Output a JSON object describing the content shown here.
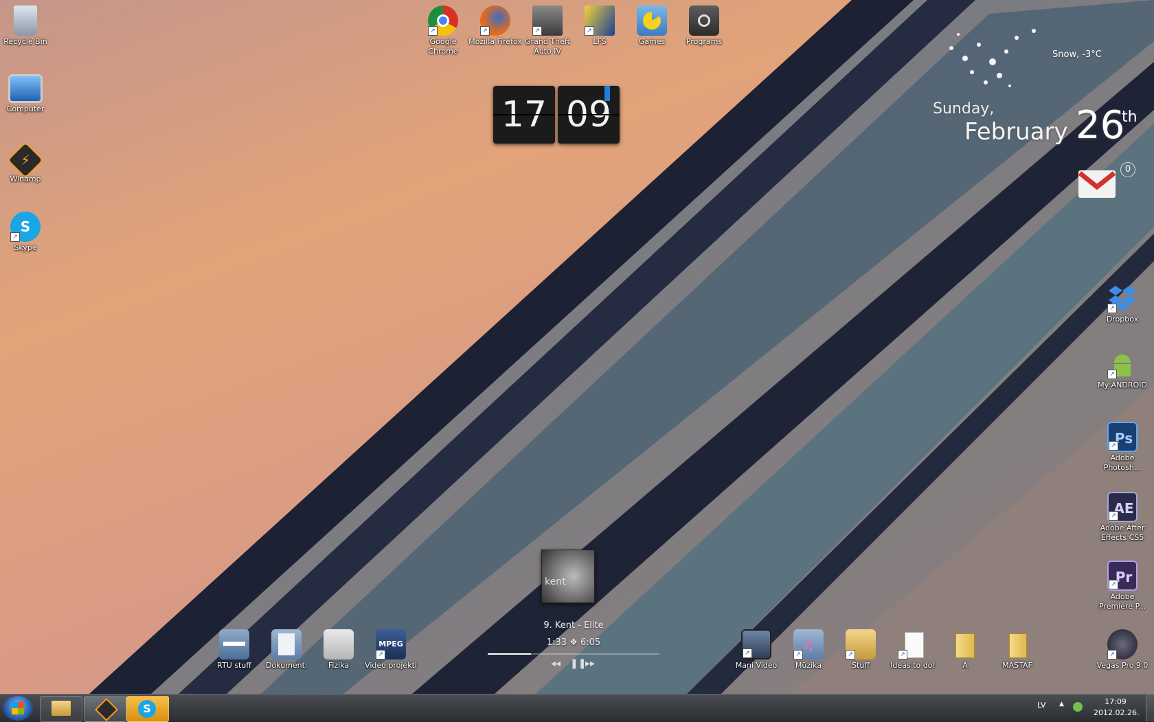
{
  "desktop": {
    "left_icons": [
      {
        "label": "Recycle Bin",
        "icon": "recycle-bin-icon"
      },
      {
        "label": "Computer",
        "icon": "computer-icon"
      },
      {
        "label": "Winamp",
        "icon": "winamp-icon"
      },
      {
        "label": "Skype",
        "icon": "skype-icon"
      }
    ],
    "top_icons": [
      {
        "label": "Google Chrome",
        "icon": "chrome-icon"
      },
      {
        "label": "Mozilla Firefox",
        "icon": "firefox-icon"
      },
      {
        "label": "Grand Theft Auto IV",
        "icon": "gta-icon"
      },
      {
        "label": "LFS",
        "icon": "lfs-icon"
      },
      {
        "label": "Games",
        "icon": "games-icon"
      },
      {
        "label": "Programs",
        "icon": "programs-icon"
      }
    ],
    "right_icons": [
      {
        "label": "Dropbox",
        "icon": "dropbox-icon"
      },
      {
        "label": "My ANDROID",
        "icon": "android-icon"
      },
      {
        "label": "Adobe Photosh...",
        "icon": "photoshop-icon",
        "glyph": "Ps"
      },
      {
        "label": "Adobe After Effects CS5",
        "icon": "after-effects-icon",
        "glyph": "AE"
      },
      {
        "label": "Adobe Premiere P...",
        "icon": "premiere-icon",
        "glyph": "Pr"
      },
      {
        "label": "Vegas Pro 9.0",
        "icon": "vegas-icon"
      }
    ],
    "bottom_left_icons": [
      {
        "label": "RTU stuff",
        "icon": "rtu-folder-icon"
      },
      {
        "label": "Dokumenti",
        "icon": "documents-icon"
      },
      {
        "label": "Fizika",
        "icon": "fizika-icon"
      },
      {
        "label": "Video projekti",
        "icon": "mpeg-icon",
        "glyph": "MPEG"
      }
    ],
    "bottom_right_icons": [
      {
        "label": "Mani Video",
        "icon": "video-icon"
      },
      {
        "label": "Mūzika",
        "icon": "music-icon"
      },
      {
        "label": "Stuff",
        "icon": "stuff-icon"
      },
      {
        "label": "Ideas to do!",
        "icon": "text-file-icon"
      },
      {
        "label": "A",
        "icon": "folder-icon"
      },
      {
        "label": "MASTAF",
        "icon": "folder-icon"
      }
    ]
  },
  "clock": {
    "hours": "17",
    "minutes": "09"
  },
  "weather": {
    "text": "Snow, -3°C"
  },
  "date_widget": {
    "day": "Sunday,",
    "month": "February",
    "date": "26",
    "suffix": "th"
  },
  "gmail": {
    "count": "0"
  },
  "player": {
    "album_text": "kent",
    "track": "9. Kent - Elite",
    "time": "1:33 ❖ 6:05",
    "progress": 0.25,
    "prev_icon": "rewind-icon",
    "pause_icon": "pause-icon",
    "next_icon": "forward-icon"
  },
  "taskbar": {
    "pinned": [
      "explorer-icon",
      "winamp-icon",
      "skype-icon"
    ],
    "lang": "LV",
    "time": "17:09",
    "date": "2012.02.26."
  },
  "colors": {
    "sky_top": "#c99a86",
    "sky_orange": "#e8a574",
    "building_dark": "#1d2236",
    "building_glass": "#4e6475",
    "building_wall": "#9a8882"
  }
}
